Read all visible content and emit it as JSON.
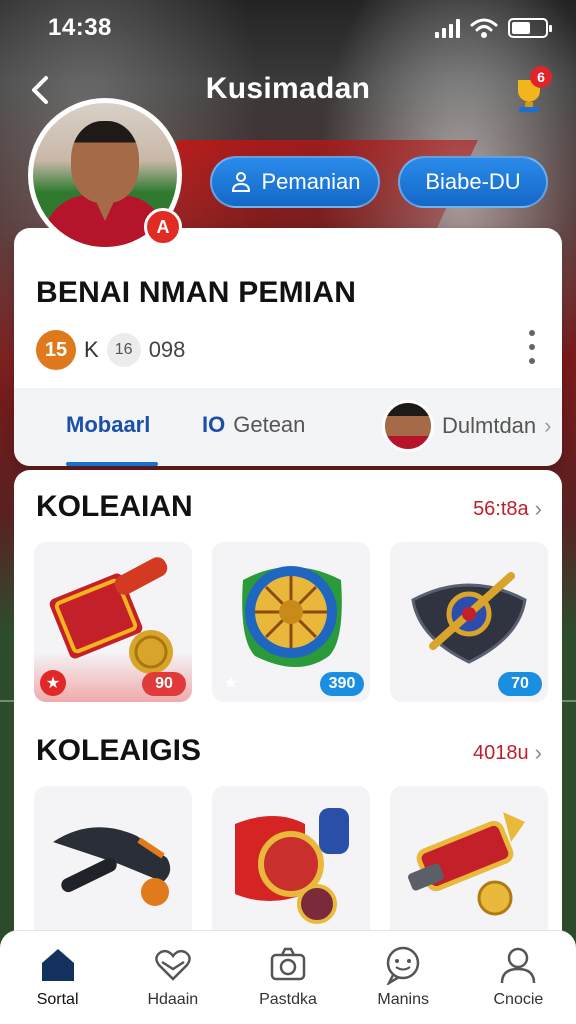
{
  "status": {
    "time": "14:38"
  },
  "header": {
    "title": "Kusimadan",
    "trophy_badge": "6"
  },
  "profile": {
    "flag_badge": "A",
    "actions": [
      {
        "label": "Pemanian",
        "icon": "person-icon"
      },
      {
        "label": "Biabe-DU"
      }
    ],
    "name": "BENAI NMAN PEMIAN",
    "level": "15",
    "meta_k": "K",
    "meta_icon": "16",
    "meta_num": "098",
    "tabs": [
      {
        "label": "Mobaarl",
        "active": true
      },
      {
        "icon_text": "IO",
        "label": "Getean"
      },
      {
        "label": "Dulmtdan"
      }
    ]
  },
  "collections": [
    {
      "title": "KOLEAIAN",
      "link": "56:t8a",
      "items": [
        {
          "name": "red-scroll-chest",
          "badge": "90",
          "badge_color": "#e03a3a",
          "corner": "star-red"
        },
        {
          "name": "green-wheel-shield",
          "badge": "390",
          "badge_color": "#1a8ee0",
          "corner": "star-gold"
        },
        {
          "name": "black-shield-sword",
          "badge": "70",
          "badge_color": "#1a8ee0"
        }
      ]
    },
    {
      "title": "KOLEAIGIS",
      "link": "4018u",
      "items": [
        {
          "name": "football-boot"
        },
        {
          "name": "red-scroll-medal"
        },
        {
          "name": "red-gold-blaster"
        }
      ]
    }
  ],
  "nav": [
    {
      "label": "Sortal",
      "icon": "home-icon",
      "active": true
    },
    {
      "label": "Hdaain",
      "icon": "heart-icon"
    },
    {
      "label": "Pastdka",
      "icon": "camera-icon"
    },
    {
      "label": "Manins",
      "icon": "chat-icon"
    },
    {
      "label": "Cnocie",
      "icon": "user-icon"
    }
  ],
  "colors": {
    "primary_blue": "#1a6fd0",
    "accent_red": "#c01f2a",
    "nav_active": "#14305c"
  }
}
